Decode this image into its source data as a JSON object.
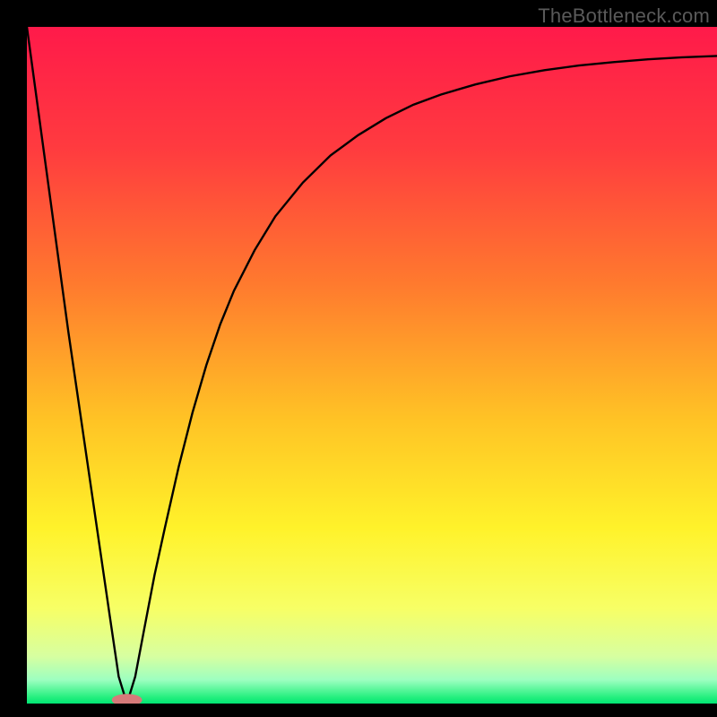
{
  "watermark": "TheBottleneck.com",
  "chart_data": {
    "type": "line",
    "title": "",
    "xlabel": "",
    "ylabel": "",
    "xlim": [
      0,
      100
    ],
    "ylim": [
      0,
      100
    ],
    "grid": false,
    "legend": false,
    "axes_visible": false,
    "background_gradient": {
      "stops": [
        {
          "pos": 0.0,
          "color": "#ff1a4a"
        },
        {
          "pos": 0.18,
          "color": "#ff3b3f"
        },
        {
          "pos": 0.38,
          "color": "#ff7a2e"
        },
        {
          "pos": 0.58,
          "color": "#ffc325"
        },
        {
          "pos": 0.74,
          "color": "#fff22a"
        },
        {
          "pos": 0.86,
          "color": "#f7ff66"
        },
        {
          "pos": 0.93,
          "color": "#d7ffa0"
        },
        {
          "pos": 0.965,
          "color": "#9dffc0"
        },
        {
          "pos": 0.99,
          "color": "#28f080"
        },
        {
          "pos": 1.0,
          "color": "#00e573"
        }
      ]
    },
    "series": [
      {
        "name": "bottleneck-curve",
        "color": "#000000",
        "width": 2.4,
        "x": [
          0,
          2,
          4,
          6,
          8,
          10,
          12,
          13.3,
          14.5,
          15.7,
          17.0,
          18.5,
          20,
          22,
          24,
          26,
          28,
          30,
          33,
          36,
          40,
          44,
          48,
          52,
          56,
          60,
          65,
          70,
          75,
          80,
          85,
          90,
          95,
          100
        ],
        "y": [
          100,
          85,
          70,
          55,
          41,
          27,
          13,
          4,
          0,
          4,
          11,
          19,
          26,
          35,
          43,
          50,
          56,
          61,
          67,
          72,
          77,
          81,
          84,
          86.5,
          88.5,
          90,
          91.5,
          92.7,
          93.6,
          94.3,
          94.8,
          95.2,
          95.5,
          95.7
        ]
      }
    ],
    "marker": {
      "name": "optimal-marker",
      "x": 14.5,
      "y": 0,
      "rx": 2.2,
      "ry": 0.9,
      "color": "#d67a7a"
    }
  }
}
